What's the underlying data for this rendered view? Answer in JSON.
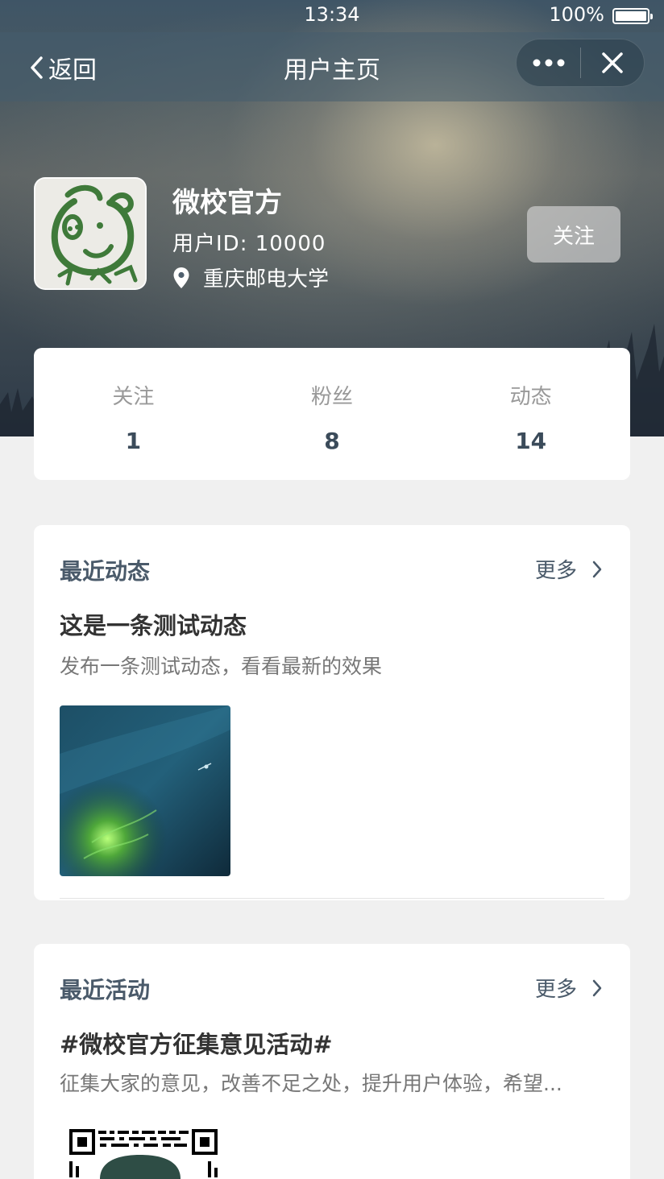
{
  "status_bar": {
    "time": "13:34",
    "battery": "100%"
  },
  "nav": {
    "back_label": "返回",
    "title": "用户主页"
  },
  "profile": {
    "name": "微校官方",
    "user_id": "用户ID: 10000",
    "location": "重庆邮电大学",
    "follow_label": "关注"
  },
  "stats": [
    {
      "label": "关注",
      "value": "1"
    },
    {
      "label": "粉丝",
      "value": "8"
    },
    {
      "label": "动态",
      "value": "14"
    }
  ],
  "recent_posts": {
    "title": "最近动态",
    "more_label": "更多",
    "post_title": "这是一条测试动态",
    "post_desc": "发布一条测试动态，看看最新的效果"
  },
  "recent_events": {
    "title": "最近活动",
    "more_label": "更多",
    "event_title": "#微校官方征集意见活动#",
    "event_desc": "征集大家的意见，改善不足之处，提升用户体验，希望..."
  },
  "colors": {
    "accent_text": "#4a5a6a",
    "page_bg": "#f0f0f0",
    "avatar_green": "#3f7a3a"
  },
  "icons": [
    "back-chevron-icon",
    "more-dots-icon",
    "close-icon",
    "location-pin-icon",
    "chevron-right-icon"
  ]
}
